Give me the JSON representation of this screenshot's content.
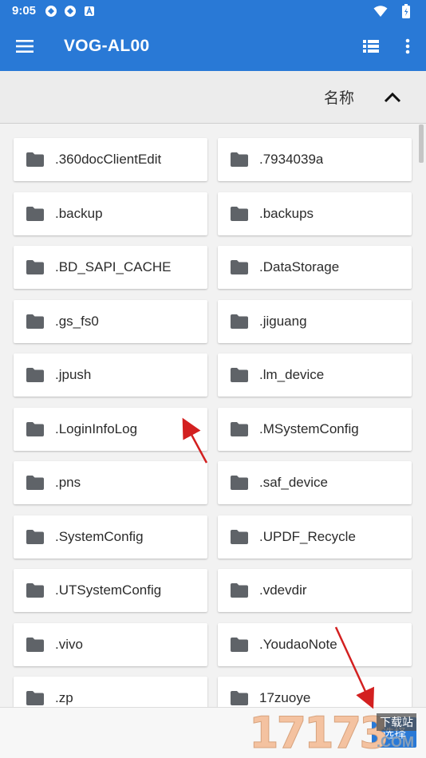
{
  "status_bar": {
    "time": "9:05",
    "icons": [
      "vpn-icon",
      "vpn-icon",
      "notification-icon"
    ],
    "right_icons": [
      "wifi-icon",
      "battery-icon"
    ]
  },
  "app_bar": {
    "title": "VOG-AL00",
    "menu_icon": "hamburger-menu-icon",
    "actions": [
      "list-view-icon",
      "more-vert-icon"
    ],
    "color": "#2979d6"
  },
  "sort": {
    "label": "名称",
    "direction_icon": "chevron-up-icon"
  },
  "folders": [
    {
      "name": ".360docClientEdit"
    },
    {
      "name": ".7934039a"
    },
    {
      "name": ".backup"
    },
    {
      "name": ".backups"
    },
    {
      "name": ".BD_SAPI_CACHE"
    },
    {
      "name": ".DataStorage"
    },
    {
      "name": ".gs_fs0"
    },
    {
      "name": ".jiguang"
    },
    {
      "name": ".jpush"
    },
    {
      "name": ".lm_device"
    },
    {
      "name": ".LoginInfoLog"
    },
    {
      "name": ".MSystemConfig"
    },
    {
      "name": ".pns"
    },
    {
      "name": ".saf_device"
    },
    {
      "name": ".SystemConfig"
    },
    {
      "name": ".UPDF_Recycle"
    },
    {
      "name": ".UTSystemConfig"
    },
    {
      "name": ".vdevdir"
    },
    {
      "name": ".vivo"
    },
    {
      "name": ".YoudaoNote"
    },
    {
      "name": ".zp"
    },
    {
      "name": "17zuoye"
    }
  ],
  "bottom": {
    "select_label": "选择"
  },
  "watermark": {
    "digits": "17173",
    "tag": "下载站",
    "com": ".COM"
  },
  "colors": {
    "accent": "#2979d6",
    "arrow": "#d32020",
    "folder_icon": "#5f6368"
  }
}
